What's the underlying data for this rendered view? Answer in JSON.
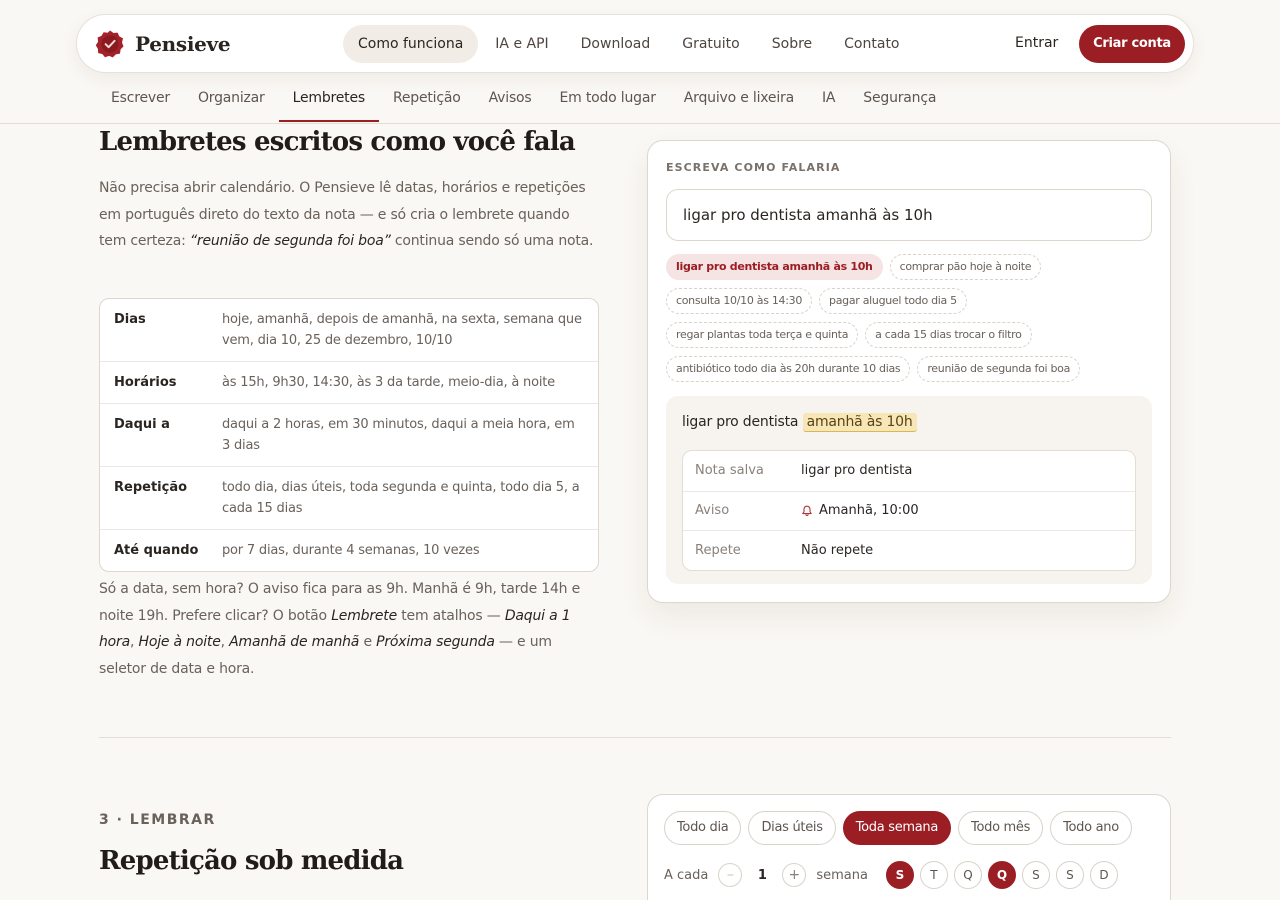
{
  "brand": {
    "name": "Pensieve"
  },
  "nav": {
    "items": [
      "Como funciona",
      "IA e API",
      "Download",
      "Gratuito",
      "Sobre",
      "Contato"
    ],
    "active_index": 0,
    "login": "Entrar",
    "signup": "Criar conta"
  },
  "subnav": {
    "items": [
      "Escrever",
      "Organizar",
      "Lembretes",
      "Repetição",
      "Avisos",
      "Em todo lugar",
      "Arquivo e lixeira",
      "IA",
      "Segurança"
    ],
    "active_index": 2
  },
  "section": {
    "title": "Lembretes escritos como você fala",
    "lead_1": "Não precisa abrir calendário. O Pensieve lê datas, horários e repetições em português direto do texto da nota — e só cria o lembrete quando tem certeza: ",
    "lead_quote": "“reunião de segunda foi boa”",
    "lead_2": " continua sendo só uma nota.",
    "reference": [
      {
        "key": "Dias",
        "value": "hoje, amanhã, depois de amanhã, na sexta, semana que vem, dia 10, 25 de dezembro, 10/10"
      },
      {
        "key": "Horários",
        "value": "às 15h, 9h30, 14:30, às 3 da tarde, meio-dia, à noite"
      },
      {
        "key": "Daqui a",
        "value": "daqui a 2 horas, em 30 minutos, daqui a meia hora, em 3 dias"
      },
      {
        "key": "Repetição",
        "value": "todo dia, dias úteis, toda segunda e quinta, todo dia 5, a cada 15 dias"
      },
      {
        "key": "Até quando",
        "value": "por 7 dias, durante 4 semanas, 10 vezes"
      }
    ],
    "footer_1": "Só a data, sem hora? O aviso fica para as 9h. Manhã é 9h, tarde 14h e noite 19h. Prefere clicar? O botão ",
    "footer_em1": "Lembrete",
    "footer_2": " tem atalhos — ",
    "footer_em2": "Daqui a 1 hora",
    "footer_3": ", ",
    "footer_em3": "Hoje à noite",
    "footer_4": ", ",
    "footer_em4": "Amanhã de manhã",
    "footer_5": " e ",
    "footer_em5": "Próxima segunda",
    "footer_6": " — e um seletor de data e hora."
  },
  "demo": {
    "label": "ESCREVA COMO FALARIA",
    "input_value": "ligar pro dentista amanhã às 10h",
    "examples": [
      [
        "ligar pro dentista amanhã às 10h",
        "comprar pão hoje à noite"
      ],
      [
        "consulta 10/10 às 14:30",
        "pagar aluguel todo dia 5"
      ],
      [
        "regar plantas toda terça e quinta",
        "a cada 15 dias trocar o filtro"
      ],
      [
        "antibiótico todo dia às 20h durante 10 dias",
        "reunião de segunda foi boa"
      ]
    ],
    "parsed_plain": "ligar pro dentista ",
    "parsed_highlight": "amanhã às 10h",
    "result": [
      {
        "key": "Nota salva",
        "value": "ligar pro dentista"
      },
      {
        "key": "Aviso",
        "value": "Amanhã, 10:00"
      },
      {
        "key": "Repete",
        "value": "Não repete"
      }
    ]
  },
  "repeat_section": {
    "kicker": "3 · LEMBRAR",
    "title": "Repetição sob medida",
    "frequencies": [
      "Todo dia",
      "Dias úteis",
      "Toda semana",
      "Todo mês",
      "Todo ano"
    ],
    "active_frequency": 2,
    "every_label": "A cada",
    "minus": "–",
    "plus": "+",
    "count": "1",
    "unit": "semana",
    "days": [
      "S",
      "T",
      "Q",
      "Q",
      "S",
      "S",
      "D"
    ],
    "selected_days": [
      0,
      3
    ]
  },
  "colors": {
    "accent": "#9b1e24",
    "background": "#faf8f4",
    "highlight": "#f6e6b8"
  }
}
